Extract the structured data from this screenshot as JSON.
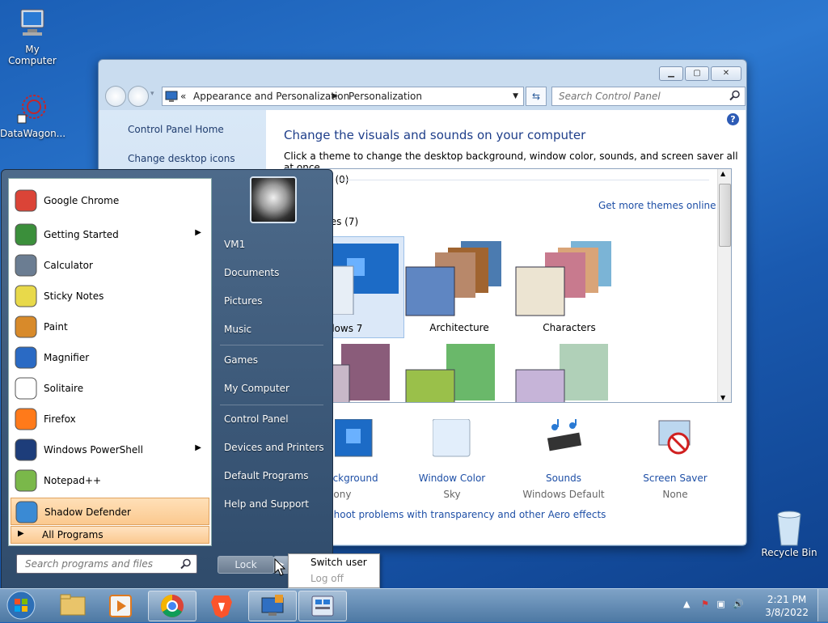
{
  "desktop": {
    "icons": [
      {
        "label": "My Computer"
      },
      {
        "label": "DataWagon..."
      },
      {
        "label": "Recycle Bin"
      }
    ]
  },
  "window": {
    "address": {
      "prefix": "«",
      "crumbs": [
        "Appearance and Personalization",
        "Personalization"
      ]
    },
    "search_placeholder": "Search Control Panel",
    "left_links": [
      "Control Panel Home",
      "Change desktop icons"
    ],
    "heading": "Change the visuals and sounds on your computer",
    "subtitle": "Click a theme to change the desktop background, window color, sounds, and screen saver all at once.",
    "my_themes": "es (0)",
    "get_more": "Get more themes online",
    "aero_themes": "mes (7)",
    "themes": [
      {
        "label": "indows 7"
      },
      {
        "label": "Architecture"
      },
      {
        "label": "Characters"
      }
    ],
    "bottom": [
      {
        "title": "Background",
        "sub": "rmony"
      },
      {
        "title": "Window Color",
        "sub": "Sky"
      },
      {
        "title": "Sounds",
        "sub": "Windows Default"
      },
      {
        "title": "Screen Saver",
        "sub": "None"
      }
    ],
    "troubleshoot": "eshoot problems with transparency and other Aero effects"
  },
  "start_menu": {
    "programs": [
      {
        "name": "Google Chrome",
        "icon": "chrome-icon"
      },
      {
        "name": "Getting Started",
        "icon": "getting-started-icon",
        "arrow": true
      },
      {
        "name": "Calculator",
        "icon": "calculator-icon"
      },
      {
        "name": "Sticky Notes",
        "icon": "sticky-notes-icon"
      },
      {
        "name": "Paint",
        "icon": "paint-icon"
      },
      {
        "name": "Magnifier",
        "icon": "magnifier-icon"
      },
      {
        "name": "Solitaire",
        "icon": "solitaire-icon"
      },
      {
        "name": "Firefox",
        "icon": "firefox-icon"
      },
      {
        "name": "Windows PowerShell",
        "icon": "powershell-icon",
        "arrow": true
      },
      {
        "name": "Notepad++",
        "icon": "notepadpp-icon"
      },
      {
        "name": "Shadow Defender",
        "icon": "shadow-defender-icon",
        "highlight": true
      }
    ],
    "all_programs": "All Programs",
    "search_placeholder": "Search programs and files",
    "right_links": [
      "VM1",
      "Documents",
      "Pictures",
      "Music",
      "Games",
      "My Computer",
      "Control Panel",
      "Devices and Printers",
      "Default Programs",
      "Help and Support"
    ],
    "lock_label": "Lock",
    "power_menu": {
      "switch_user": "Switch user",
      "log_off": "Log off"
    }
  },
  "taskbar": {
    "time": "2:21 PM",
    "date": "3/8/2022"
  }
}
